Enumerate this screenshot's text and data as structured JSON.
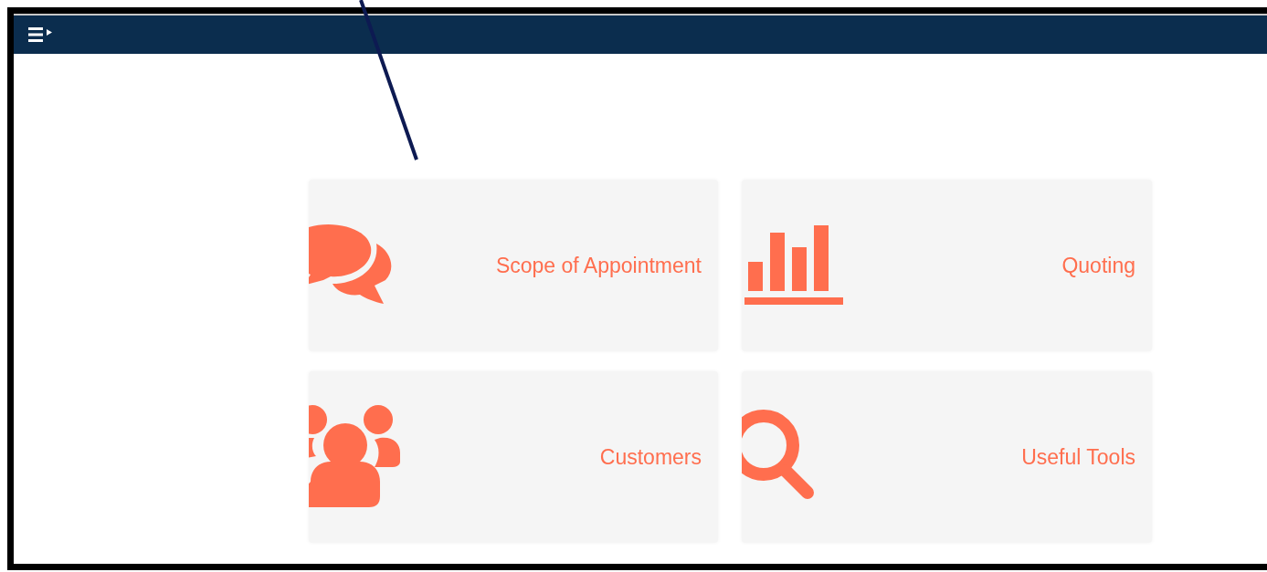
{
  "header": {
    "menu_button": {
      "expanded": false
    }
  },
  "tiles": [
    {
      "label": "Scope of Appointment",
      "kind": "chat"
    },
    {
      "label": "Quoting",
      "kind": "chart"
    },
    {
      "label": "Customers",
      "kind": "people"
    },
    {
      "label": "Useful Tools",
      "kind": "search"
    }
  ]
}
